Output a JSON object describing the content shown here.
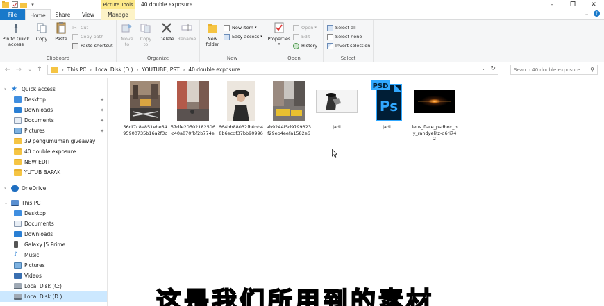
{
  "window": {
    "title": "40 double exposure",
    "context_tab_group": "Picture Tools"
  },
  "tabs": {
    "file": "File",
    "home": "Home",
    "share": "Share",
    "view": "View",
    "manage": "Manage"
  },
  "ribbon": {
    "clipboard": {
      "label": "Clipboard",
      "pin": "Pin to Quick access",
      "copy": "Copy",
      "paste": "Paste",
      "cut": "Cut",
      "copy_path": "Copy path",
      "paste_shortcut": "Paste shortcut"
    },
    "organize": {
      "label": "Organize",
      "move_to": "Move to",
      "copy_to": "Copy to",
      "delete": "Delete",
      "rename": "Rename"
    },
    "new": {
      "label": "New",
      "new_folder": "New folder",
      "new_item": "New item",
      "easy_access": "Easy access"
    },
    "open": {
      "label": "Open",
      "properties": "Properties",
      "open": "Open",
      "edit": "Edit",
      "history": "History"
    },
    "select": {
      "label": "Select",
      "select_all": "Select all",
      "select_none": "Select none",
      "invert_selection": "Invert selection"
    }
  },
  "address": {
    "crumbs": [
      "This PC",
      "Local Disk (D:)",
      "YOUTUBE, PST",
      "40 double exposure"
    ],
    "search_placeholder": "Search 40 double exposure"
  },
  "navpane": {
    "quick_access": "Quick access",
    "quick_items": [
      "Desktop",
      "Downloads",
      "Documents",
      "Pictures",
      "39 pengumuman giveaway",
      "40 double exposure",
      "NEW EDIT",
      "YUTUB BAPAK"
    ],
    "onedrive": "OneDrive",
    "this_pc": "This PC",
    "pc_items": [
      "Desktop",
      "Documents",
      "Downloads",
      "Galaxy J5 Prime",
      "Music",
      "Pictures",
      "Videos",
      "Local Disk (C:)",
      "Local Disk (D:)"
    ]
  },
  "files": [
    {
      "name": "56df7c8e851ebe6495900735b16a2f3c",
      "thumb": "street-photo"
    },
    {
      "name": "57dfe20502182506c40a870fbf2b774e",
      "thumb": "city-photo"
    },
    {
      "name": "664bb88032fb0bb48b6ecdf37bb90996",
      "thumb": "portrait-photo"
    },
    {
      "name": "ab9244f5d9799323f29eb4eefa1582e6",
      "thumb": "taxi-photo"
    },
    {
      "name": "jadi",
      "thumb": "bw-image"
    },
    {
      "name": "jadi",
      "thumb": "psd-file",
      "psd_label": "PSD",
      "ps_label": "Ps"
    },
    {
      "name": "lens_flare_psdbox_by_randyelitz-d6ri742",
      "thumb": "lens-flare"
    }
  ],
  "subtitle": "这是我们所用到的素材",
  "colors": {
    "file_tab": "#1979ca",
    "manage_tab": "#fde98a",
    "selection": "#cce8ff",
    "ps_blue": "#001e36",
    "ps_accent": "#31a8ff"
  }
}
